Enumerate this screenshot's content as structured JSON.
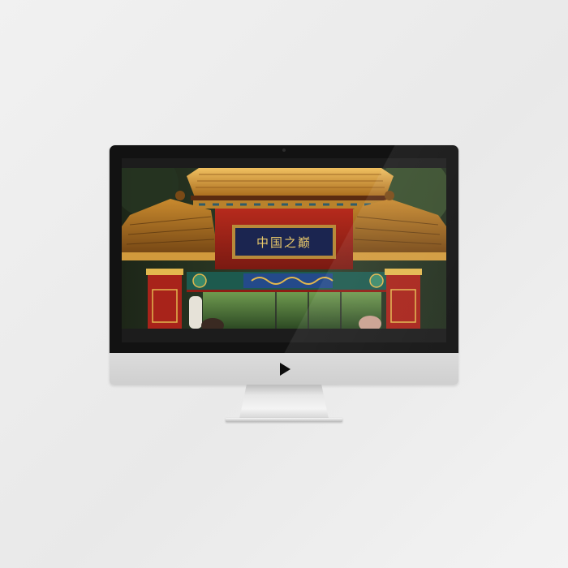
{
  "device": {
    "type": "desktop-monitor",
    "logo_icon": "play-triangle-icon",
    "bezel_color": "#121212",
    "chin_color": "#d6d6d6"
  },
  "screen": {
    "content": "photo",
    "sign_text": "中国之巅",
    "colors": {
      "roof_gold": "#d9a441",
      "beam_red": "#a8231a",
      "sign_navy": "#1b2550",
      "foliage_green": "#2f4f2a"
    }
  }
}
